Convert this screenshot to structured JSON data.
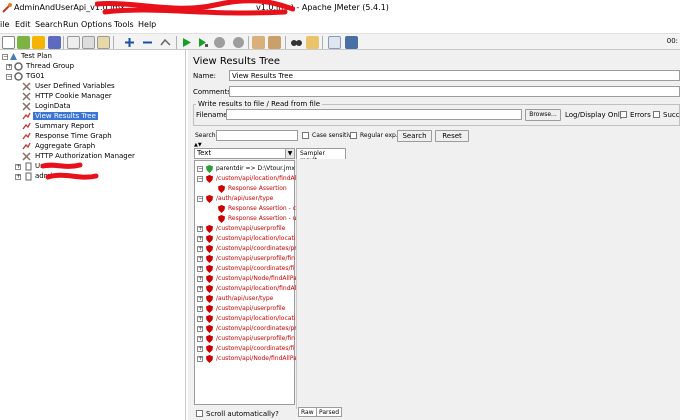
{
  "window": {
    "title_prefix": "AdminAndUserApi_v1.0.jmx",
    "title_suffix": "_v1.0.jmx) - Apache JMeter (5.4.1)"
  },
  "menu": [
    "File",
    "Edit",
    "Search",
    "Run",
    "Options",
    "Tools",
    "Help"
  ],
  "toolbar": {
    "buttons": [
      "new-icon",
      "templates-icon",
      "open-icon",
      "save-icon",
      "cut-icon",
      "copy-icon",
      "paste-icon",
      "expand-icon",
      "collapse-icon",
      "toggle-icon",
      "start-icon",
      "start-no-pause-icon",
      "stop-icon",
      "shutdown-icon",
      "clear-icon",
      "clear-all-icon",
      "search-icon",
      "reset-search-icon",
      "function-helper-icon",
      "help-icon"
    ],
    "time": "00:"
  },
  "tree": {
    "items": [
      {
        "label": "Test Plan"
      },
      {
        "label": "Thread Group"
      },
      {
        "label": "TG01"
      },
      {
        "label": "User Defined Variables"
      },
      {
        "label": "HTTP Cookie Manager"
      },
      {
        "label": "LoginData"
      },
      {
        "label": "View Results Tree"
      },
      {
        "label": "Summary Report"
      },
      {
        "label": "Response Time Graph"
      },
      {
        "label": "Aggregate Graph"
      },
      {
        "label": "HTTP Authorization Manager"
      },
      {
        "label": "User"
      },
      {
        "label": "admin"
      }
    ]
  },
  "panel": {
    "title": "View Results Tree",
    "name_label": "Name:",
    "name_value": "View Results Tree",
    "comments_label": "Comments:",
    "write_legend": "Write results to file / Read from file",
    "filename_label": "Filename",
    "browse": "Browse...",
    "log_display": "Log/Display Only:",
    "errors": "Errors",
    "successes": "Succes",
    "search_label": "Search:",
    "case_sensitive": "Case sensitive",
    "regular_exp": "Regular exp.",
    "search_btn": "Search",
    "reset_btn": "Reset",
    "combo_value": "Text",
    "sampler_tab": "Sampler result",
    "raw_tab": "Raw",
    "parsed_tab": "Parsed",
    "scroll_auto": "Scroll automatically?"
  },
  "results": [
    {
      "label": "parentdir =>   D:\\Vtour.jmx",
      "status": "ok"
    },
    {
      "label": "/custom/api/location/findAl",
      "status": "error"
    },
    {
      "label": "Response Assertion",
      "status": "error"
    },
    {
      "label": "/auth/api/user/type",
      "status": "error"
    },
    {
      "label": "Response Assertion - co",
      "status": "error"
    },
    {
      "label": "Response Assertion - us",
      "status": "error"
    },
    {
      "label": "/custom/api/userprofile",
      "status": "error"
    },
    {
      "label": "/custom/api/location/locati",
      "status": "error"
    },
    {
      "label": "/custom/api/coordinates/pr",
      "status": "error"
    },
    {
      "label": "/custom/api/userprofile/fin",
      "status": "error"
    },
    {
      "label": "/custom/api/coordinates/fi",
      "status": "error"
    },
    {
      "label": "/custom/api/Node/findAllPa",
      "status": "error"
    },
    {
      "label": "/custom/api/location/findAl",
      "status": "error"
    },
    {
      "label": "/auth/api/user/type",
      "status": "error"
    },
    {
      "label": "/custom/api/userprofile",
      "status": "error"
    },
    {
      "label": "/custom/api/location/locati",
      "status": "error"
    },
    {
      "label": "/custom/api/coordinates/pr",
      "status": "error"
    },
    {
      "label": "/custom/api/userprofile/fin",
      "status": "error"
    },
    {
      "label": "/custom/api/coordinates/fi",
      "status": "error"
    },
    {
      "label": "/custom/api/Node/findAllPa",
      "status": "error"
    }
  ],
  "colors": {
    "error": "#cc0000",
    "selected": "#3875d7",
    "scribble": "#e8101a"
  }
}
